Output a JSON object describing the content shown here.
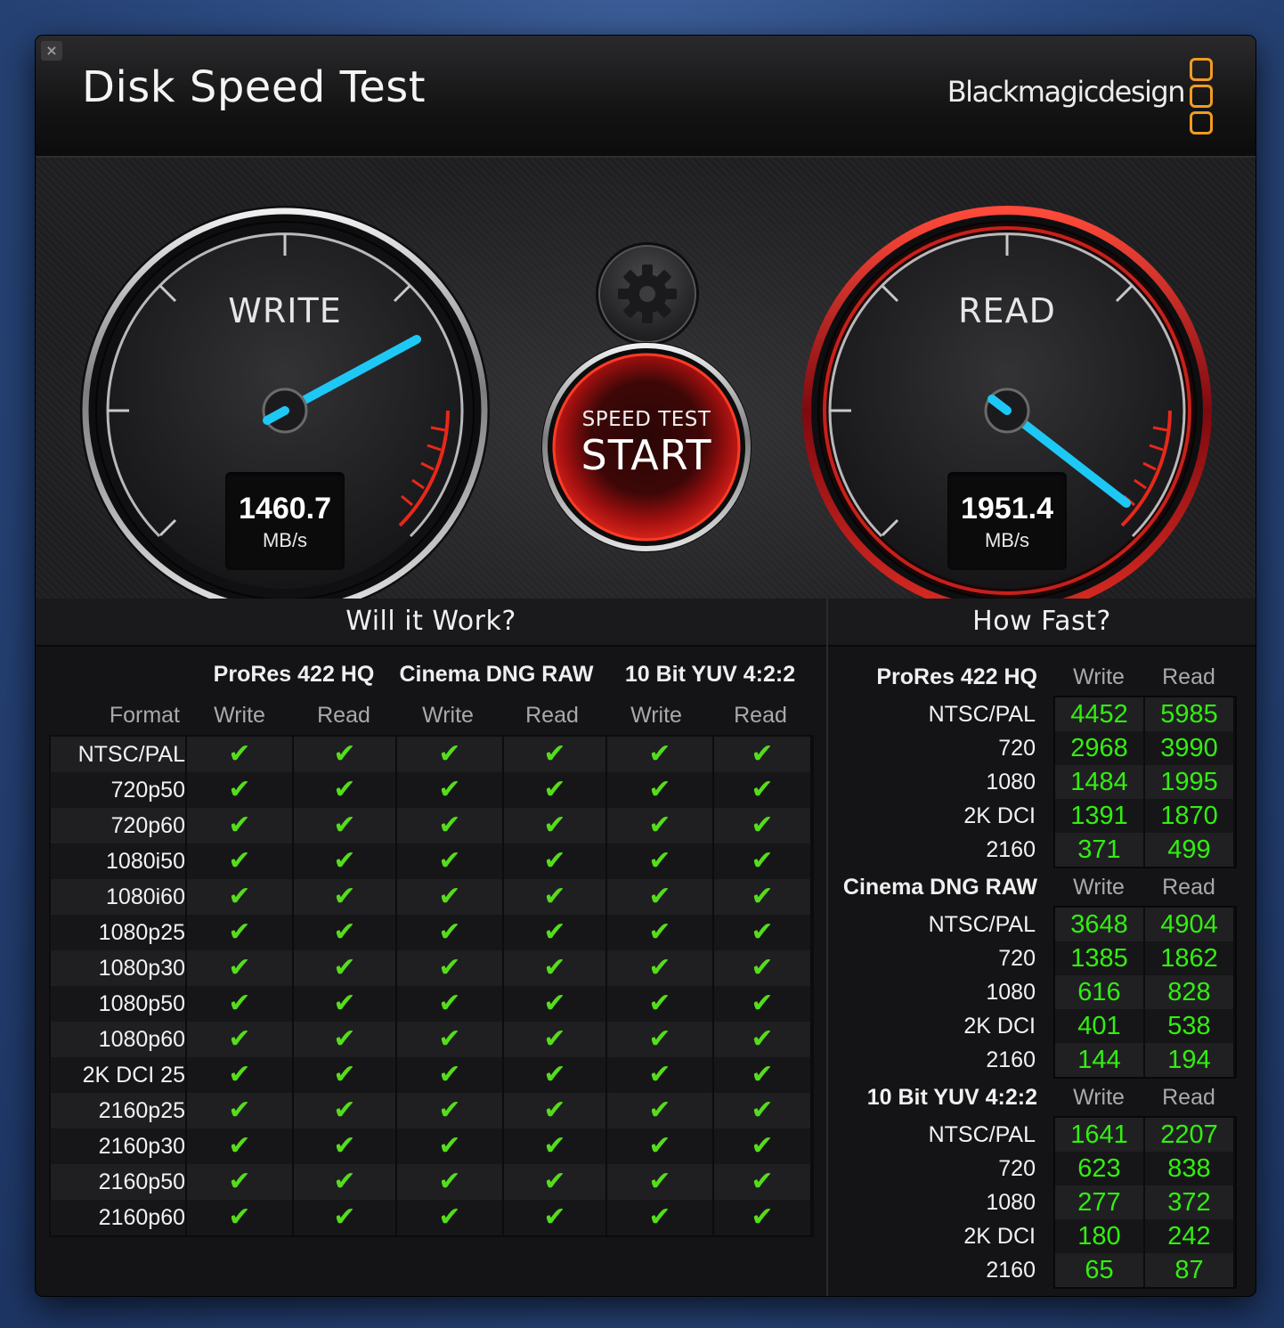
{
  "window": {
    "close_label": "×",
    "title": "Disk Speed Test",
    "brand": "Blackmagicdesign"
  },
  "gauges": {
    "write": {
      "label": "WRITE",
      "value": "1460.7",
      "unit": "MB/s"
    },
    "read": {
      "label": "READ",
      "value": "1951.4",
      "unit": "MB/s"
    },
    "start": {
      "small": "SPEED TEST",
      "big": "START"
    }
  },
  "will_it_work": {
    "heading": "Will it Work?",
    "format_label": "Format",
    "groups": [
      "ProRes 422 HQ",
      "Cinema DNG RAW",
      "10 Bit YUV 4:2:2"
    ],
    "col_labels": [
      "Write",
      "Read",
      "Write",
      "Read",
      "Write",
      "Read"
    ],
    "check_glyph": "✔",
    "rows": [
      {
        "format": "NTSC/PAL"
      },
      {
        "format": "720p50"
      },
      {
        "format": "720p60"
      },
      {
        "format": "1080i50"
      },
      {
        "format": "1080i60"
      },
      {
        "format": "1080p25"
      },
      {
        "format": "1080p30"
      },
      {
        "format": "1080p50"
      },
      {
        "format": "1080p60"
      },
      {
        "format": "2K DCI 25"
      },
      {
        "format": "2160p25"
      },
      {
        "format": "2160p30"
      },
      {
        "format": "2160p50"
      },
      {
        "format": "2160p60"
      }
    ]
  },
  "how_fast": {
    "heading": "How Fast?",
    "write_label": "Write",
    "read_label": "Read",
    "groups": [
      {
        "name": "ProRes 422 HQ",
        "rows": [
          {
            "format": "NTSC/PAL",
            "write": "4452",
            "read": "5985"
          },
          {
            "format": "720",
            "write": "2968",
            "read": "3990"
          },
          {
            "format": "1080",
            "write": "1484",
            "read": "1995"
          },
          {
            "format": "2K DCI",
            "write": "1391",
            "read": "1870"
          },
          {
            "format": "2160",
            "write": "371",
            "read": "499"
          }
        ]
      },
      {
        "name": "Cinema DNG RAW",
        "rows": [
          {
            "format": "NTSC/PAL",
            "write": "3648",
            "read": "4904"
          },
          {
            "format": "720",
            "write": "1385",
            "read": "1862"
          },
          {
            "format": "1080",
            "write": "616",
            "read": "828"
          },
          {
            "format": "2K DCI",
            "write": "401",
            "read": "538"
          },
          {
            "format": "2160",
            "write": "144",
            "read": "194"
          }
        ]
      },
      {
        "name": "10 Bit YUV 4:2:2",
        "rows": [
          {
            "format": "NTSC/PAL",
            "write": "1641",
            "read": "2207"
          },
          {
            "format": "720",
            "write": "623",
            "read": "838"
          },
          {
            "format": "1080",
            "write": "277",
            "read": "372"
          },
          {
            "format": "2K DCI",
            "write": "180",
            "read": "242"
          },
          {
            "format": "2160",
            "write": "65",
            "read": "87"
          }
        ]
      }
    ]
  },
  "colors": {
    "accent_needle": "#1ec8f5",
    "check_green": "#55dd1c",
    "value_green": "#33ee11",
    "read_ring": "#b3131a",
    "brand_orange": "#f29b22"
  }
}
